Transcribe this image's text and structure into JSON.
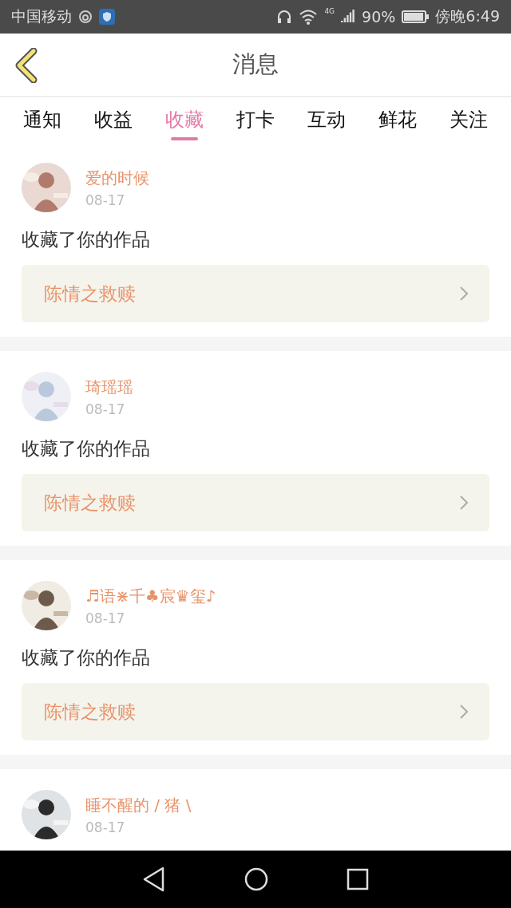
{
  "status_bar": {
    "carrier": "中国移动",
    "network": "4G",
    "battery": "90%",
    "time": "傍晚6:49"
  },
  "header": {
    "title": "消息"
  },
  "tabs": [
    {
      "label": "通知",
      "selected": false
    },
    {
      "label": "收益",
      "selected": false
    },
    {
      "label": "收藏",
      "selected": true
    },
    {
      "label": "打卡",
      "selected": false
    },
    {
      "label": "互动",
      "selected": false
    },
    {
      "label": "鲜花",
      "selected": false
    },
    {
      "label": "关注",
      "selected": false
    }
  ],
  "messages": [
    {
      "user": "爱的时候",
      "date": "08-17",
      "text": "收藏了你的作品",
      "work": "陈情之救赎"
    },
    {
      "user": "琦瑶瑶",
      "date": "08-17",
      "text": "收藏了你的作品",
      "work": "陈情之救赎"
    },
    {
      "user": "♬语⋇千♣宸♛玺♪",
      "date": "08-17",
      "text": "收藏了你的作品",
      "work": "陈情之救赎"
    },
    {
      "user": "睡不醒的 / 猪 \\",
      "date": "08-17"
    }
  ]
}
